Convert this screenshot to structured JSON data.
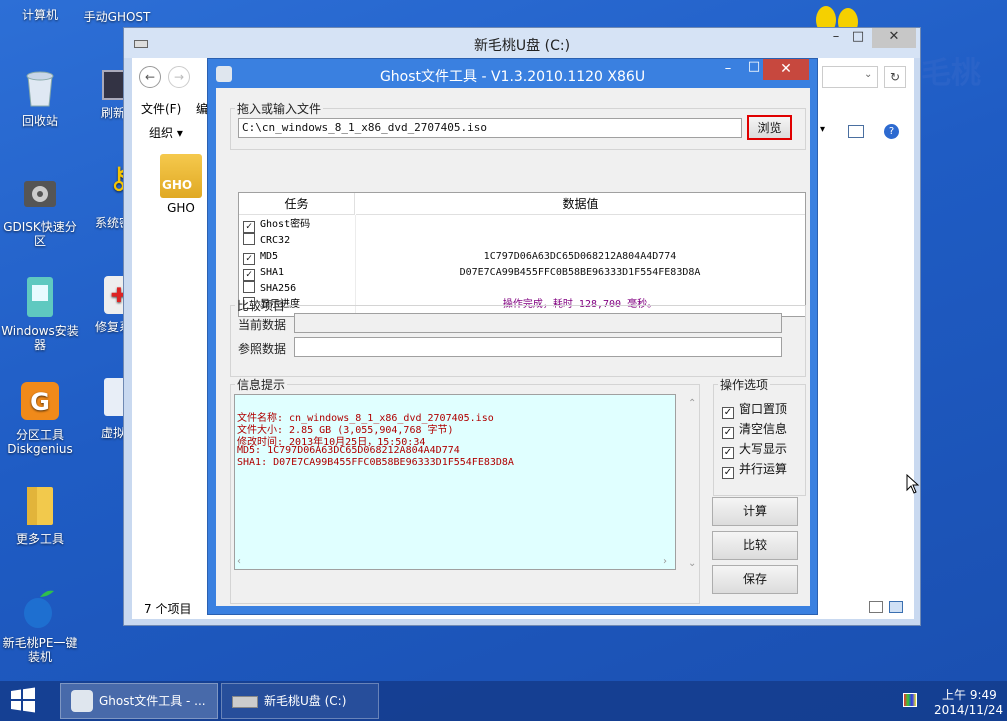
{
  "desktop": {
    "icons": [
      {
        "label": "计算机"
      },
      {
        "label": "回收站"
      },
      {
        "label": "GDISK快速分区"
      },
      {
        "label": "Windows安装器"
      },
      {
        "label": "分区工具Diskgenius"
      },
      {
        "label": "更多工具"
      },
      {
        "label": "新毛桃PE一键装机"
      }
    ],
    "icons_col2": [
      {
        "label": "手动GHOST"
      },
      {
        "label": "刷新桌"
      },
      {
        "label": "系统密码"
      },
      {
        "label": "修复系统"
      },
      {
        "label": "虚拟光"
      }
    ],
    "logo_text": "毛桃"
  },
  "explorer": {
    "title": "新毛桃U盘 (C:)",
    "menu_file": "文件(F)",
    "menu_edit": "编",
    "organize": "组织",
    "file_label": "GHO",
    "file_icon_text": "GHO",
    "status": "7 个项目"
  },
  "ghost": {
    "title": "Ghost文件工具 - V1.3.2010.1120 X86U",
    "input_group": "拖入或输入文件",
    "file_path": "C:\\cn_windows_8_1_x86_dvd_2707405.iso",
    "browse": "浏览",
    "table": {
      "col_task": "任务",
      "col_value": "数据值",
      "rows": [
        {
          "task": "Ghost密码",
          "checked": "✓",
          "value": ""
        },
        {
          "task": "CRC32",
          "checked": "",
          "value": ""
        },
        {
          "task": "MD5",
          "checked": "✓",
          "value": "1C797D06A63DC65D068212A804A4D774"
        },
        {
          "task": "SHA1",
          "checked": "✓",
          "value": "D07E7CA99B455FFC0B58BE96333D1F554FE83D8A"
        },
        {
          "task": "SHA256",
          "checked": "",
          "value": ""
        },
        {
          "task": "显示进度",
          "checked": "",
          "value": "操作完成，耗时 128,700 毫秒。"
        }
      ]
    },
    "compare_group": "比较项目",
    "current_data": "当前数据",
    "ref_data": "参照数据",
    "info_group": "信息提示",
    "info_lines": [
      "文件名称: cn_windows_8_1_x86_dvd_2707405.iso",
      "文件大小: 2.85 GB (3,055,904,768 字节)",
      "修改时间: 2013年10月25日，15:50:34",
      "MD5: 1C797D06A63DC65D068212A804A4D774",
      "SHA1: D07E7CA99B455FFC0B58BE96333D1F554FE83D8A"
    ],
    "options_group": "操作选项",
    "options": [
      {
        "label": "窗口置顶",
        "checked": "✓"
      },
      {
        "label": "清空信息",
        "checked": "✓"
      },
      {
        "label": "大写显示",
        "checked": "✓"
      },
      {
        "label": "并行运算",
        "checked": "✓"
      }
    ],
    "btn_calc": "计算",
    "btn_compare": "比较",
    "btn_save": "保存"
  },
  "taskbar": {
    "items": [
      {
        "label": "Ghost文件工具 - ..."
      },
      {
        "label": "新毛桃U盘 (C:)"
      }
    ],
    "time": "上午 9:49",
    "date": "2014/11/24"
  },
  "colors": {
    "desktop": "#2d6fd6",
    "dialog_frame": "#3a80e0",
    "close": "#c7483e",
    "info_bg": "#e0ffff",
    "info_text": "#b00000",
    "browse_highlight": "#e00000"
  }
}
